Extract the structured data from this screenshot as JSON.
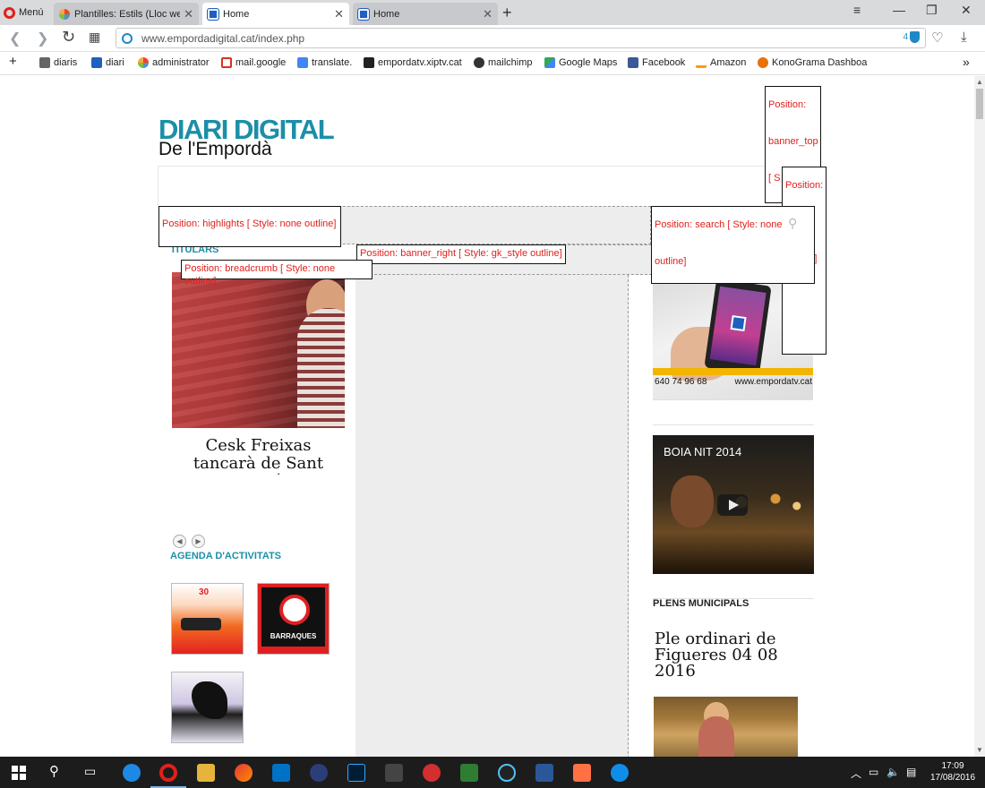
{
  "browser": {
    "menu_label": "Menú",
    "tabs": [
      {
        "title": "Plantilles: Estils (Lloc web)",
        "active": false,
        "favicon": "joomla-icon"
      },
      {
        "title": "Home",
        "active": true,
        "favicon": "diari-icon"
      },
      {
        "title": "Home",
        "active": false,
        "favicon": "diari-icon"
      }
    ],
    "new_tab_symbol": "+",
    "url": "www.empordadigital.cat/index.php",
    "url_badge_count": "4",
    "bookmarks": [
      {
        "label": "diaris",
        "icon": "folder-icon",
        "color": "#555555"
      },
      {
        "label": "diari",
        "icon": "diari-icon",
        "color": "#1f5fbf"
      },
      {
        "label": "administrator",
        "icon": "joomla-icon",
        "color": "#f44321"
      },
      {
        "label": "mail.google",
        "icon": "gmail-icon",
        "color": "#d93025"
      },
      {
        "label": "translate.",
        "icon": "translate-icon",
        "color": "#4285f4"
      },
      {
        "label": "empordatv.xiptv.cat",
        "icon": "xiptv-icon",
        "color": "#222222"
      },
      {
        "label": "mailchimp",
        "icon": "mailchimp-icon",
        "color": "#333333"
      },
      {
        "label": "Google Maps",
        "icon": "maps-icon",
        "color": "#34a853"
      },
      {
        "label": "Facebook",
        "icon": "facebook-icon",
        "color": "#3b5998"
      },
      {
        "label": "Amazon",
        "icon": "amazon-icon",
        "color": "#ff9900"
      },
      {
        "label": "KonoGrama Dashboa",
        "icon": "konograma-icon",
        "color": "#e8710a"
      }
    ]
  },
  "page": {
    "logo_title": "DIARI DIGITAL",
    "logo_subtitle": "De l'Empordà",
    "accent_color": "#1b8fa8",
    "positions": {
      "banner_top": "Position: banner_top [ S",
      "right_top": "Position: none outline]",
      "highlights": "Position: highlights [ Style: none outline]",
      "search": "Position: search [ Style: none outline]",
      "banner_right": "Position: banner_right [ Style: gk_style outline]",
      "breadcrumb": "Position: breadcrumb [ Style: none outline]"
    },
    "titulars_heading": "TITULARS",
    "news_title": "Cesk Freixas tancarà de Sant Domí",
    "agenda_heading": "AGENDA D'ACTIVITATS",
    "agenda_thumb2_label": "BARRAQUES",
    "agenda_thumb1_label": "30",
    "side_banner": {
      "phone_number": "640 74 96 68",
      "website": "www.empordatv.cat"
    },
    "video_title": "BOIA NIT 2014",
    "plens_heading": "PLENS MUNICIPALS",
    "plens_title": "Ple ordinari de Figueres 04 08 2016"
  },
  "taskbar": {
    "time": "17:09",
    "date": "17/08/2016"
  }
}
